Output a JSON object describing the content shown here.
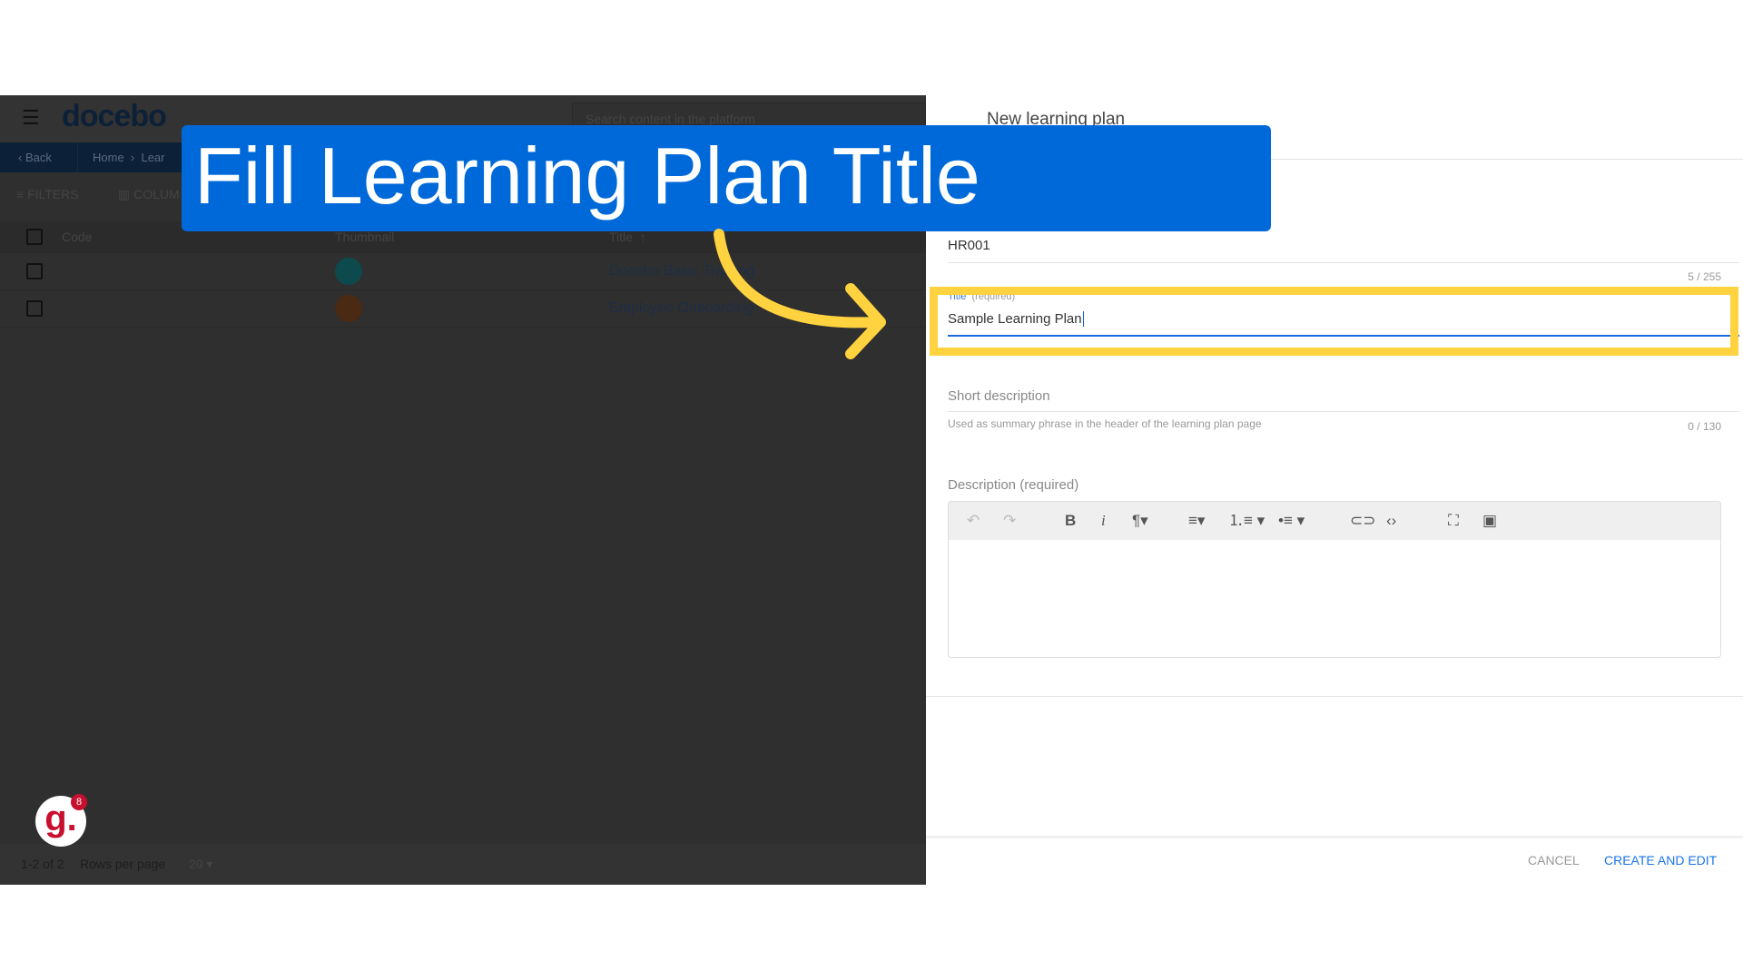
{
  "banner": {
    "text": "Fill Learning Plan Title",
    "color": "#0069d9",
    "highlight_color": "#ffd23f"
  },
  "header": {
    "logo": "docebo",
    "search_placeholder": "Search content in the platform",
    "menu_icon": "hamburger-icon"
  },
  "nav": {
    "back": "Back",
    "breadcrumb": [
      "Home",
      "Lear"
    ]
  },
  "toolbar": {
    "filters": "FILTERS",
    "columns": "COLUM"
  },
  "table": {
    "headers": [
      "Code",
      "Thumbnail",
      "Title"
    ],
    "rows": [
      {
        "code": "",
        "title": "Docebo Basic Training"
      },
      {
        "code": "",
        "title": "Employee Onboarding"
      }
    ]
  },
  "pagination": {
    "range": "1-2 of 2",
    "rows_label": "Rows per page",
    "rows_value": "20"
  },
  "widget": {
    "badge": "8"
  },
  "panel": {
    "title": "New learning plan",
    "code_value": "HR001",
    "code_count": "5 / 255",
    "title_label": "Title",
    "title_required": "(required)",
    "title_value": "Sample Learning Plan",
    "short_desc_placeholder": "Short description",
    "short_desc_help": "Used as summary phrase in the header of the learning plan page",
    "short_desc_count": "0 / 130",
    "desc_label": "Description (required)",
    "cancel": "CANCEL",
    "create": "CREATE AND EDIT"
  }
}
